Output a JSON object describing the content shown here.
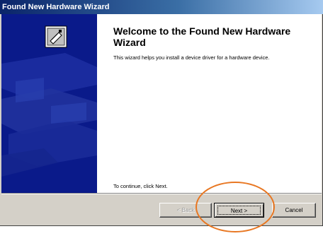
{
  "window": {
    "title": "Found New Hardware Wizard"
  },
  "content": {
    "heading": "Welcome to the Found New Hardware Wizard",
    "description": "This wizard helps you install a device driver for a hardware device.",
    "continue_hint": "To continue, click Next."
  },
  "buttons": {
    "back_label": "< Back",
    "next_label": "Next >",
    "cancel_label": "Cancel"
  },
  "icons": {
    "banner_icon": "hardware-card-icon"
  },
  "colors": {
    "title_bar": "#0a246a",
    "banner": "#0a1a8a",
    "highlight_ring": "#e87722"
  }
}
